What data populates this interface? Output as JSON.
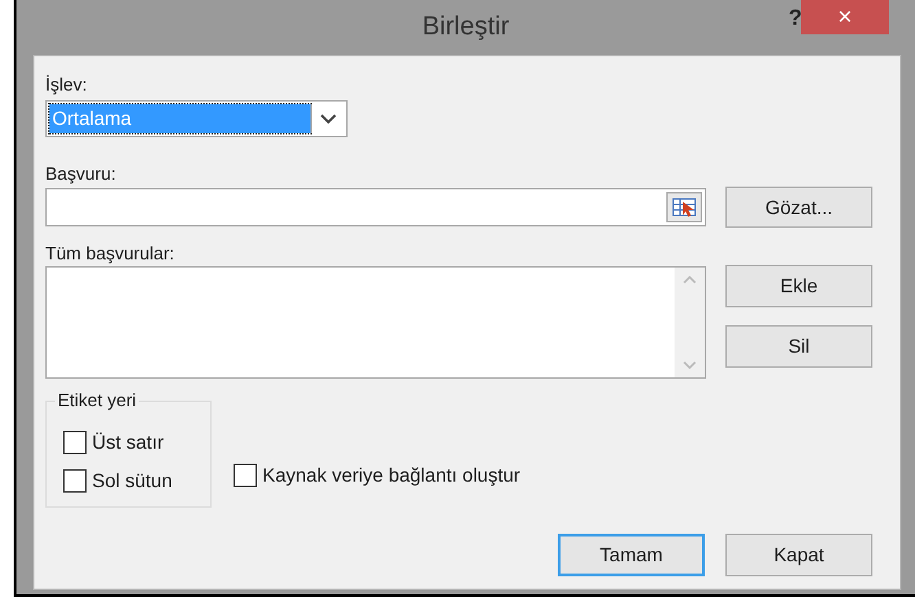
{
  "window": {
    "title": "Birleştir",
    "help": "?",
    "close": "×"
  },
  "function": {
    "label": "İşlev:",
    "value": "Ortalama",
    "selected": true
  },
  "reference": {
    "label": "Başvuru:",
    "browse_button": "Gözat..."
  },
  "all_references": {
    "label": "Tüm başvurular:",
    "add_button": "Ekle",
    "delete_button": "Sil"
  },
  "labels_group": {
    "title": "Etiket yeri",
    "checkboxes": [
      {
        "label": "Üst satır",
        "checked": false
      },
      {
        "label": "Sol sütun",
        "checked": false
      }
    ]
  },
  "link_checkbox": {
    "label": "Kaynak veriye bağlantı oluştur",
    "checked": false
  },
  "buttons": [
    {
      "label": "Tamam",
      "default": true
    },
    {
      "label": "Kapat",
      "default": false
    }
  ]
}
